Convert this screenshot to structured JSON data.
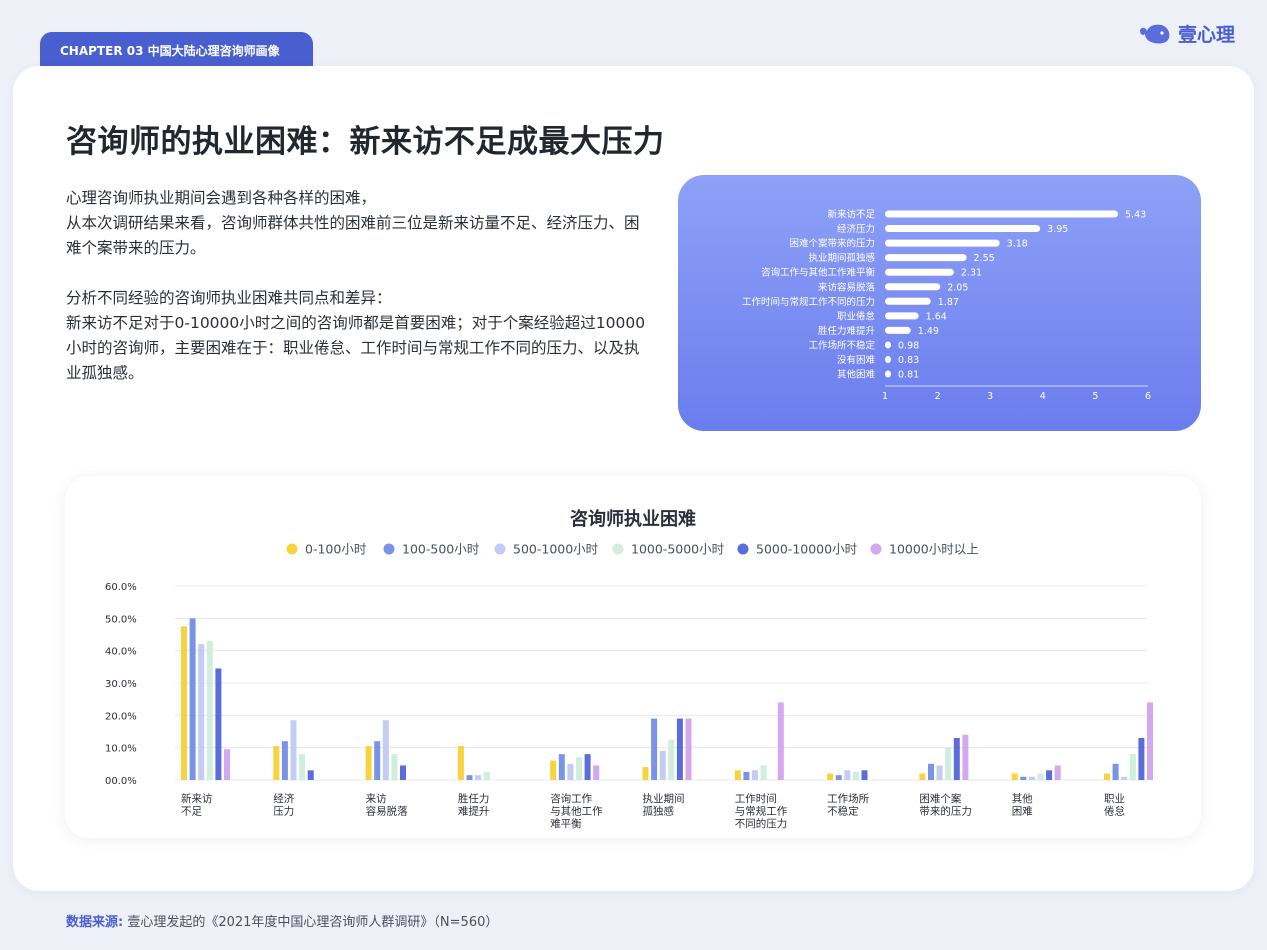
{
  "header": {
    "chapter": "CHAPTER 03  中国大陆心理咨询师画像",
    "brand": "壹心理"
  },
  "title": "咨询师的执业困难：新来访不足成最大压力",
  "paragraphs": [
    "心理咨询师执业期间会遇到各种各样的困难，\n从本次调研结果来看，咨询师群体共性的困难前三位是新来访量不足、经济压力、困难个案带来的压力。",
    "分析不同经验的咨询师执业困难共同点和差异：\n新来访不足对于0-10000小时之间的咨询师都是首要困难；对于个案经验超过10000小时的咨询师，主要困难在于：职业倦怠、工作时间与常规工作不同的压力、以及执业孤独感。"
  ],
  "source": {
    "label": "数据来源:",
    "text": "壹心理发起的《2021年度中国心理咨询师人群调研》（N=560）"
  },
  "chart_data": [
    {
      "type": "bar",
      "orientation": "horizontal",
      "categories": [
        "新来访不足",
        "经济压力",
        "困难个案带来的压力",
        "执业期间孤独感",
        "咨询工作与其他工作难平衡",
        "来访容易脱落",
        "工作时间与常规工作不同的压力",
        "职业倦怠",
        "胜任力难提升",
        "工作场所不稳定",
        "没有困难",
        "其他困难"
      ],
      "values": [
        5.43,
        3.95,
        3.18,
        2.55,
        2.31,
        2.05,
        1.87,
        1.64,
        1.49,
        0.98,
        0.83,
        0.81
      ],
      "value_labels": [
        "5.43",
        "3.95",
        "3.18",
        "2.55",
        "2.31",
        "2.05",
        "1.87",
        "1.64",
        "1.49",
        "0.98",
        "0.83",
        "0.81"
      ],
      "xticks": [
        "1",
        "2",
        "3",
        "4",
        "5",
        "6"
      ],
      "xlim": [
        1,
        6
      ],
      "colors": {
        "bar": "#ffffff",
        "text": "#ffffff"
      }
    },
    {
      "type": "bar",
      "title": "咨询师执业困难",
      "categories": [
        [
          "新来访",
          "不足"
        ],
        [
          "经济",
          "压力"
        ],
        [
          "来访",
          "容易脱落"
        ],
        [
          "胜任力",
          "难提升"
        ],
        [
          "咨询工作",
          "与其他工作",
          "难平衡"
        ],
        [
          "执业期间",
          "孤独感"
        ],
        [
          "工作时间",
          "与常规工作",
          "不同的压力"
        ],
        [
          "工作场所",
          "不稳定"
        ],
        [
          "困难个案",
          "带来的压力"
        ],
        [
          "其他",
          "困难"
        ],
        [
          "职业",
          "倦怠"
        ]
      ],
      "yticks": [
        "60.0%",
        "50.0%",
        "40.0%",
        "30.0%",
        "20.0%",
        "10.0%",
        "00.0%"
      ],
      "ylim": [
        0,
        60
      ],
      "legend_position": "top-center",
      "series": [
        {
          "name": "0-100小时",
          "color": "#f9d33f",
          "values": [
            47.5,
            10.5,
            10.5,
            10.5,
            6,
            4,
            3,
            2,
            2,
            2,
            2
          ]
        },
        {
          "name": "100-500小时",
          "color": "#7b93e6",
          "values": [
            50,
            12,
            12,
            1.5,
            8,
            19,
            2.5,
            1.5,
            5,
            1,
            5
          ]
        },
        {
          "name": "500-1000小时",
          "color": "#c3cdf3",
          "values": [
            42,
            18.5,
            18.5,
            1.5,
            5,
            9,
            3,
            3,
            4.5,
            1,
            1
          ]
        },
        {
          "name": "1000-5000小时",
          "color": "#cfeedd",
          "values": [
            43,
            8,
            8,
            2.5,
            7,
            12.5,
            4.5,
            2.5,
            10,
            2,
            8
          ]
        },
        {
          "name": "5000-10000小时",
          "color": "#5a6ddb",
          "values": [
            34.5,
            3,
            4.5,
            0,
            8,
            19,
            0,
            3,
            13,
            3,
            13
          ]
        },
        {
          "name": "10000小时以上",
          "color": "#d3a8ee",
          "values": [
            9.5,
            0,
            0,
            0,
            4.5,
            19,
            24,
            0,
            14,
            4.5,
            24
          ]
        }
      ]
    }
  ]
}
